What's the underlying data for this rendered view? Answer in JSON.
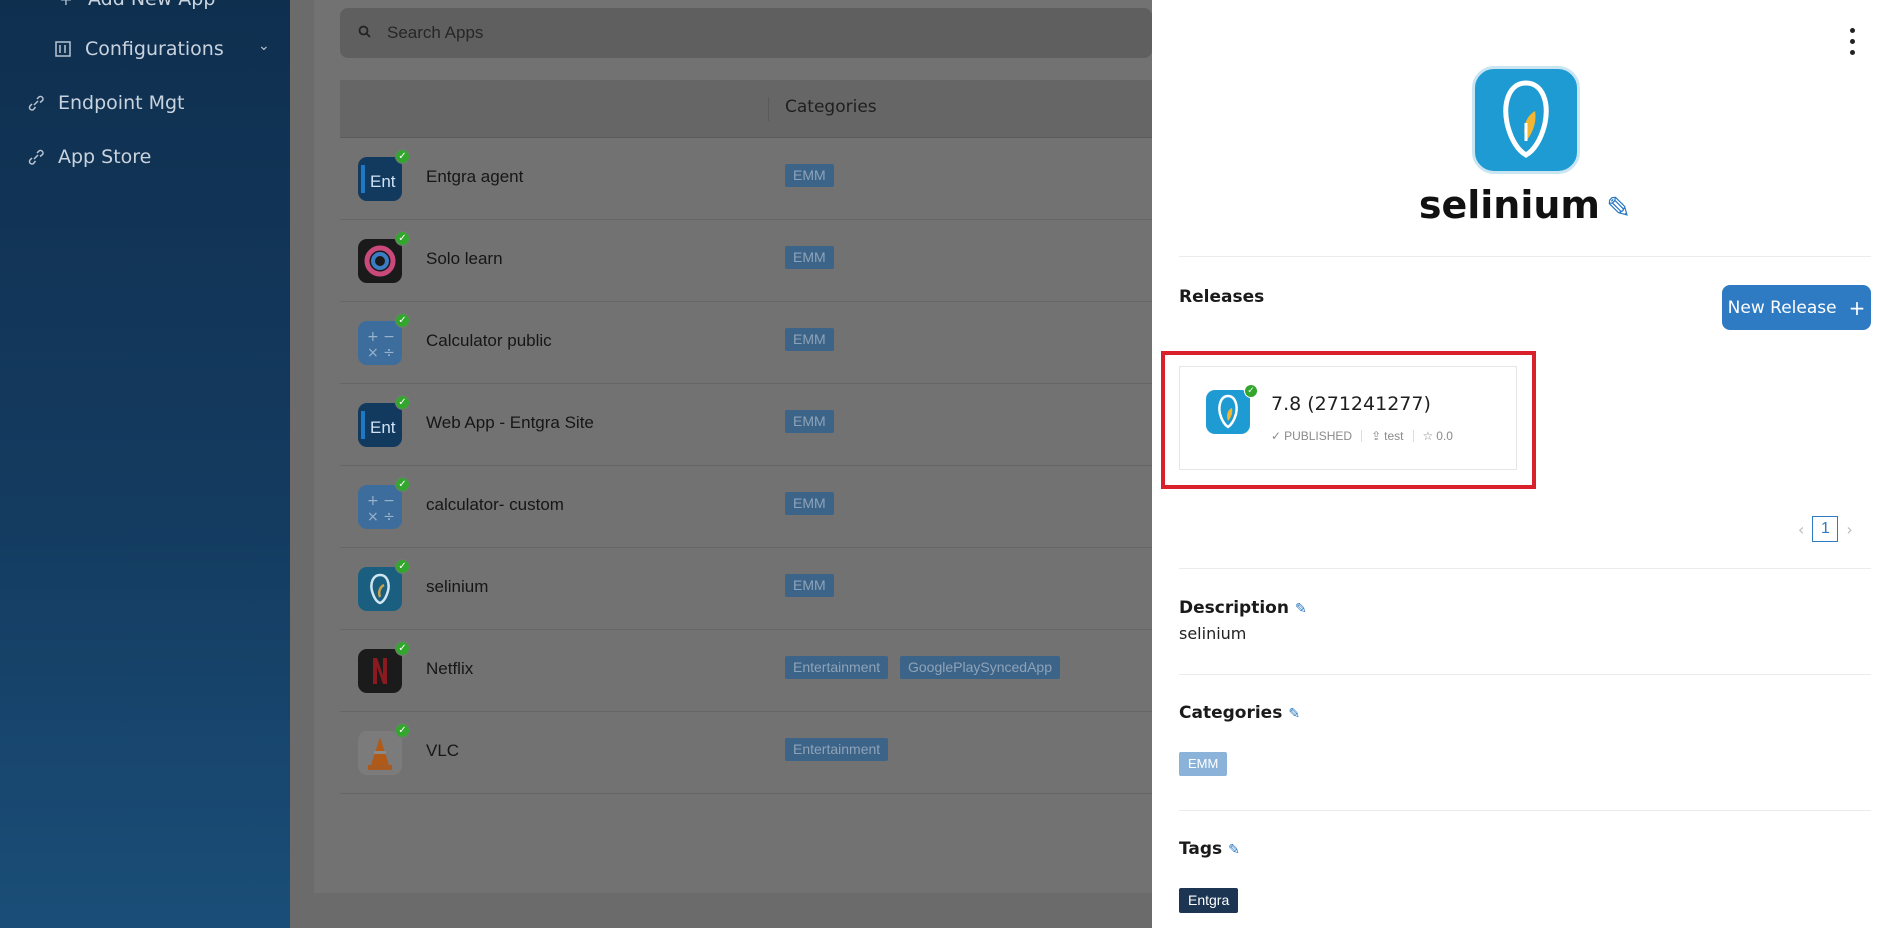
{
  "sidebar": {
    "items": [
      {
        "label": "Add New App",
        "icon": "plus-icon"
      },
      {
        "label": "Configurations",
        "icon": "config-icon"
      },
      {
        "label": "Endpoint Mgt",
        "icon": "link-icon"
      },
      {
        "label": "App Store",
        "icon": "link-icon"
      }
    ]
  },
  "search": {
    "placeholder": "Search Apps"
  },
  "table": {
    "category_header": "Categories",
    "rows": [
      {
        "name": "Entgra agent",
        "tags": [
          "EMM"
        ],
        "icon": "entgra-icon"
      },
      {
        "name": "Solo learn",
        "tags": [
          "EMM"
        ],
        "icon": "sololearn-icon"
      },
      {
        "name": "Calculator public",
        "tags": [
          "EMM"
        ],
        "icon": "calculator-icon"
      },
      {
        "name": "Web App - Entgra Site",
        "tags": [
          "EMM"
        ],
        "icon": "entgra-icon"
      },
      {
        "name": "calculator- custom",
        "tags": [
          "EMM"
        ],
        "icon": "calculator-icon"
      },
      {
        "name": "selinium",
        "tags": [
          "EMM"
        ],
        "icon": "selinium-icon"
      },
      {
        "name": "Netflix",
        "tags": [
          "Entertainment",
          "GooglePlaySyncedApp"
        ],
        "icon": "netflix-icon"
      },
      {
        "name": "VLC",
        "tags": [
          "Entertainment"
        ],
        "icon": "vlc-icon"
      }
    ]
  },
  "panel": {
    "app_name": "selinium",
    "releases_title": "Releases",
    "new_release_label": "New Release",
    "release": {
      "version": "7.8 (271241277)",
      "status": "PUBLISHED",
      "type": "test",
      "rating": "0.0"
    },
    "page": "1",
    "description_title": "Description",
    "description": "selinium",
    "categories_title": "Categories",
    "categories": [
      "EMM"
    ],
    "tags_title": "Tags",
    "tags": [
      "Entgra"
    ]
  },
  "colors": {
    "accent": "#2e7bc4",
    "highlight": "#d8212b",
    "published": "#33a62e"
  }
}
